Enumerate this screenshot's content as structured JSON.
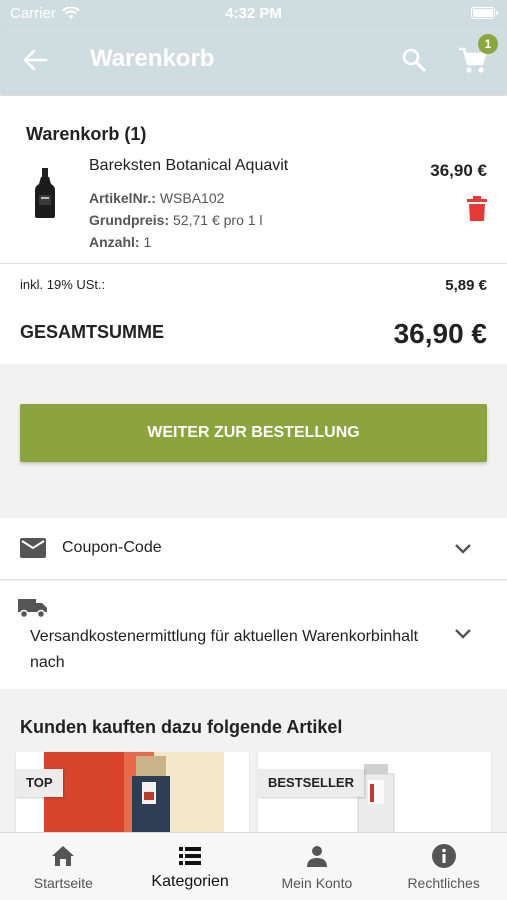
{
  "status": {
    "carrier": "Carrier",
    "time": "4:32 PM"
  },
  "appbar": {
    "title": "Warenkorb",
    "cart_count": "1"
  },
  "colors": {
    "accent": "#8ca43e",
    "appbar": "#d0dde0",
    "delete": "#e53935"
  },
  "cart": {
    "heading": "Warenkorb (1)",
    "item": {
      "name": "Bareksten Botanical Aquavit",
      "price": "36,90 €",
      "article_label": "ArtikelNr.:",
      "article_value": "WSBA102",
      "baseprice_label": "Grundpreis:",
      "baseprice_value": "52,71 € pro 1 l",
      "qty_label": "Anzahl:",
      "qty_value": "1"
    }
  },
  "totals": {
    "vat_label": "inkl. 19% USt.:",
    "vat_value": "5,89 €",
    "sum_label": "GESAMTSUMME",
    "sum_value": "36,90 €"
  },
  "order_button": "WEITER ZUR BESTELLUNG",
  "coupon": {
    "label": "Coupon-Code"
  },
  "shipping": {
    "label": "Versandkostenermittlung für aktuellen Warenkorbinhalt nach"
  },
  "related": {
    "heading": "Kunden kauften dazu folgende Artikel",
    "products": [
      {
        "tag": "TOP"
      },
      {
        "tag": "BESTSELLER"
      }
    ]
  },
  "tabs": [
    {
      "label": "Startseite",
      "icon": "home-icon"
    },
    {
      "label": "Kategorien",
      "icon": "list-icon"
    },
    {
      "label": "Mein Konto",
      "icon": "person-icon"
    },
    {
      "label": "Rechtliches",
      "icon": "info-icon"
    }
  ]
}
